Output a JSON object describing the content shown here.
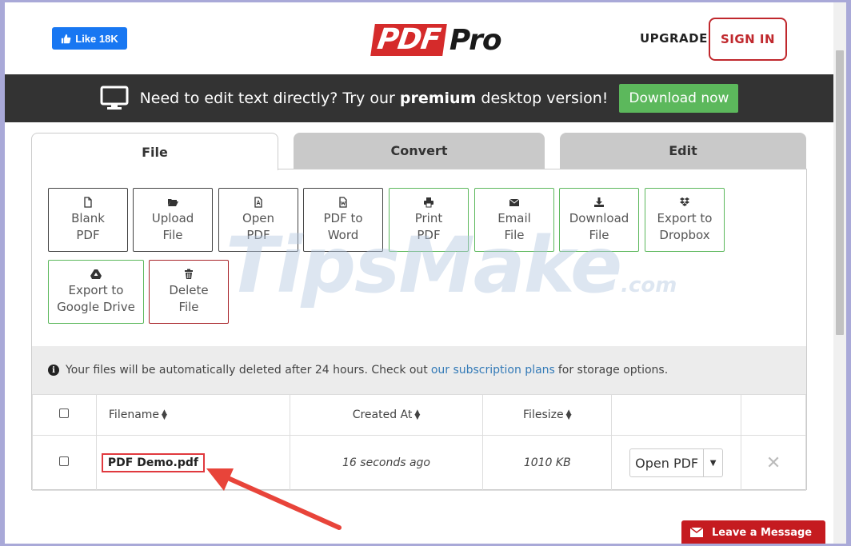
{
  "header": {
    "fb_like": "Like 18K",
    "logo_pdf": "PDF",
    "logo_pro": "Pro",
    "upgrade": "UPGRADE",
    "sign_in": "SIGN IN"
  },
  "banner": {
    "text_pre": "Need to edit text directly? Try our ",
    "text_bold": "premium",
    "text_post": " desktop version!",
    "button": "Download now"
  },
  "tabs": [
    {
      "label": "File"
    },
    {
      "label": "Convert"
    },
    {
      "label": "Edit"
    }
  ],
  "tools": [
    {
      "line1": "Blank",
      "line2": "PDF",
      "icon": "file-icon"
    },
    {
      "line1": "Upload",
      "line2": "File",
      "icon": "folder-open-icon"
    },
    {
      "line1": "Open",
      "line2": "PDF",
      "icon": "pdf-file-icon"
    },
    {
      "line1": "PDF to",
      "line2": "Word",
      "icon": "word-file-icon"
    },
    {
      "line1": "Print",
      "line2": "PDF",
      "icon": "print-icon"
    },
    {
      "line1": "Email",
      "line2": "File",
      "icon": "envelope-icon"
    },
    {
      "line1": "Download",
      "line2": "File",
      "icon": "download-icon"
    },
    {
      "line1": "Export to",
      "line2": "Dropbox",
      "icon": "dropbox-icon"
    },
    {
      "line1": "Export to",
      "line2": "Google Drive",
      "icon": "google-drive-icon"
    },
    {
      "line1": "Delete",
      "line2": "File",
      "icon": "trash-icon"
    }
  ],
  "watermark": {
    "text": "TipsMake",
    "suffix": ".com"
  },
  "info": {
    "pre": "Your files will be automatically deleted after 24 hours. Check out",
    "link": "our subscription plans",
    "post": "for storage options."
  },
  "table": {
    "headers": [
      "Filename",
      "Created At",
      "Filesize"
    ],
    "rows": [
      {
        "filename": "PDF Demo.pdf",
        "created": "16 seconds ago",
        "size": "1010 KB",
        "action": "Open PDF"
      }
    ]
  },
  "chat": {
    "label": "Leave a Message"
  },
  "colors": {
    "brand_red": "#d52b2b",
    "tool_green": "#5cb85c",
    "banner_bg": "#333333",
    "link_blue": "#337ab7"
  }
}
